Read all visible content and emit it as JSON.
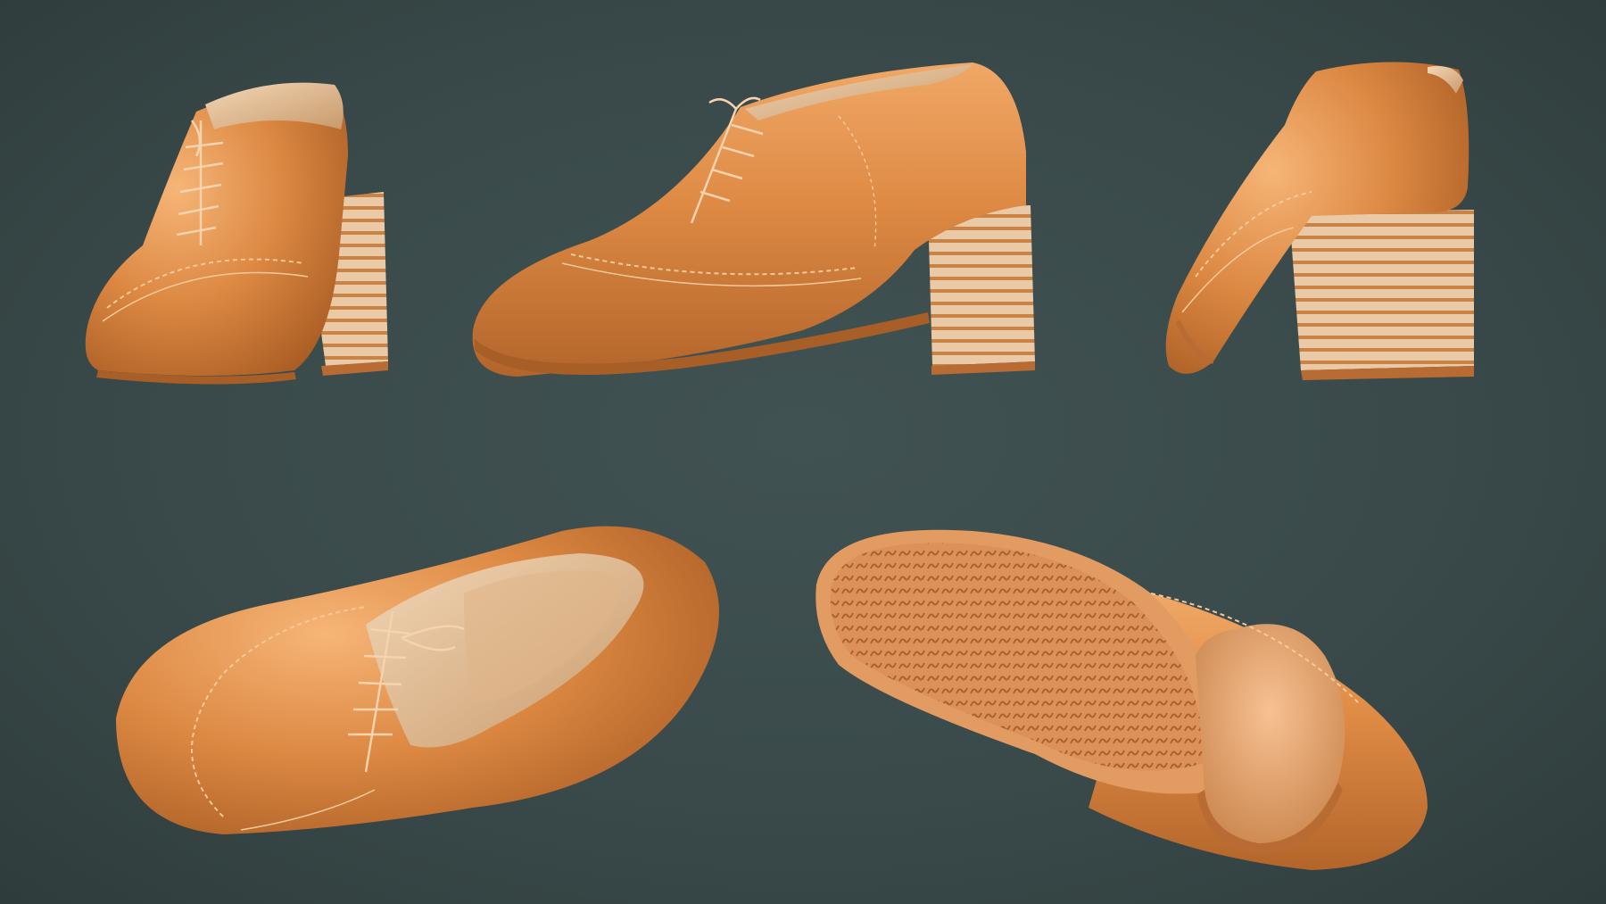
{
  "scene": {
    "background_color": "#3d4d4d",
    "leather_color": "#d9853f",
    "leather_highlight": "#f0a866",
    "leather_shadow": "#a65a22",
    "lining_color": "#e6c19b",
    "heel_stripe_light": "#e8c7a3",
    "heel_stripe_dark": "#c98445",
    "sole_color": "#e0955a",
    "stitch_color": "#f7c99a"
  },
  "views": [
    {
      "id": "front-three-quarter",
      "icon": "shoe-front-view"
    },
    {
      "id": "side",
      "icon": "shoe-side-view"
    },
    {
      "id": "back-three-quarter",
      "icon": "shoe-back-view"
    },
    {
      "id": "top",
      "icon": "shoe-top-view"
    },
    {
      "id": "bottom",
      "icon": "shoe-sole-view"
    }
  ]
}
